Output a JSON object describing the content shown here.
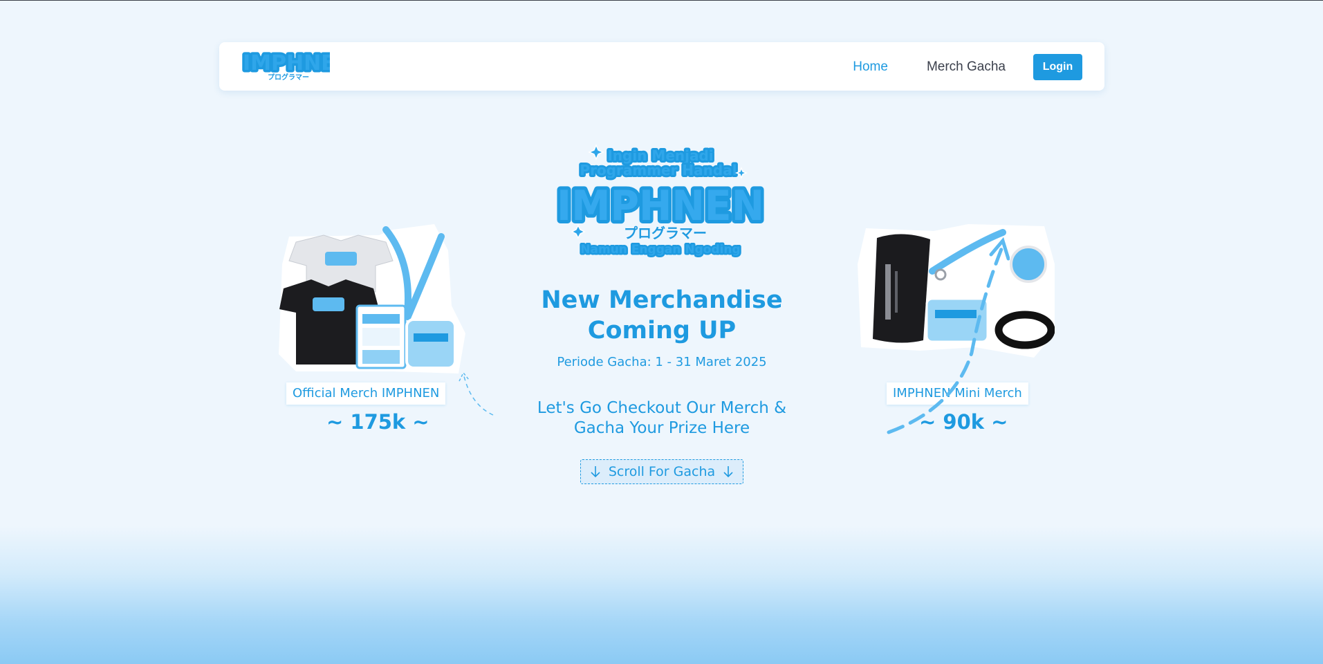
{
  "nav": {
    "logo_text": "IMPHNEN",
    "logo_subtext": "プログラマー",
    "links": [
      {
        "label": "Home",
        "active": true
      },
      {
        "label": "Merch Gacha",
        "active": false
      }
    ],
    "login_label": "Login"
  },
  "hero": {
    "logo_top": "Ingin Menjadi",
    "logo_top2": "Programmer Handal",
    "logo_main": "IMPHNEN",
    "logo_jp": "プログラマー",
    "logo_bottom": "Namun Enggan Ngoding",
    "headline_line1": "New Merchandise",
    "headline_line2": "Coming UP",
    "period": "Periode Gacha: 1 - 31 Maret 2025",
    "cta_line1": "Let's Go Checkout Our Merch &",
    "cta_line2": "Gacha Your Prize Here",
    "scroll_label": "Scroll For Gacha"
  },
  "merch": [
    {
      "title": "Official Merch IMPHNEN",
      "price": "~ 175k ~"
    },
    {
      "title": "IMPHNEN Mini Merch",
      "price": "~ 90k ~"
    }
  ],
  "colors": {
    "accent": "#1e9ae0",
    "background": "#eef6fd",
    "nav_text": "#3a3f4b"
  }
}
